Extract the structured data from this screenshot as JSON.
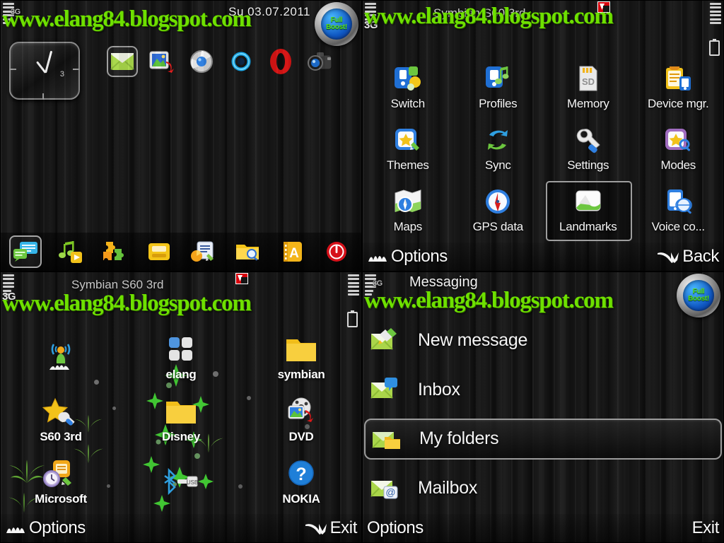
{
  "watermark": "www.elang84.blogspot.com",
  "colors": {
    "accent_green": "#6ee000",
    "label_white": "#f4f4f4",
    "selection_border": "#9e9e9e",
    "folder_yellow": "#f5c330",
    "opera_red": "#d61414"
  },
  "panel_home": {
    "status": {
      "network": "3G",
      "date": "Su 03.07.2011",
      "badge_line1": "Full",
      "badge_line2": "Boost!"
    },
    "clock": {
      "hour_marker": "3"
    },
    "shortcuts": [
      {
        "name": "messaging-shortcut",
        "label": "Messaging",
        "selected": true
      },
      {
        "name": "gallery-shortcut",
        "label": "Gallery",
        "selected": false
      },
      {
        "name": "web-browser-shortcut",
        "label": "Web",
        "selected": false
      },
      {
        "name": "widget-shortcut",
        "label": "Widget",
        "selected": false
      },
      {
        "name": "opera-browser-shortcut",
        "label": "Opera",
        "selected": false
      },
      {
        "name": "camera-shortcut",
        "label": "Camera",
        "selected": false
      }
    ],
    "dock": [
      {
        "name": "dock-messaging",
        "label": "Messaging",
        "selected": true
      },
      {
        "name": "dock-music-player",
        "label": "Music player",
        "selected": false
      },
      {
        "name": "dock-applications",
        "label": "Applications",
        "selected": false
      },
      {
        "name": "dock-gallery",
        "label": "Gallery",
        "selected": false
      },
      {
        "name": "dock-office",
        "label": "Office",
        "selected": false
      },
      {
        "name": "dock-file-manager",
        "label": "File manager",
        "selected": false
      },
      {
        "name": "dock-notes",
        "label": "Notes",
        "selected": false
      },
      {
        "name": "dock-power",
        "label": "Power",
        "selected": false
      }
    ]
  },
  "panel_tools": {
    "status": {
      "network": "3G",
      "operator": "Symbian S60 3rd"
    },
    "grid": [
      {
        "label": "Switch",
        "icon": "switch-icon",
        "selected": false
      },
      {
        "label": "Profiles",
        "icon": "profiles-icon",
        "selected": false
      },
      {
        "label": "Memory",
        "icon": "memory-card-icon",
        "selected": false
      },
      {
        "label": "Device mgr.",
        "icon": "device-manager-icon",
        "selected": false
      },
      {
        "label": "Themes",
        "icon": "themes-icon",
        "selected": false
      },
      {
        "label": "Sync",
        "icon": "sync-icon",
        "selected": false
      },
      {
        "label": "Settings",
        "icon": "settings-wrench-icon",
        "selected": false
      },
      {
        "label": "Modes",
        "icon": "modes-icon",
        "selected": false
      },
      {
        "label": "Maps",
        "icon": "maps-icon",
        "selected": false
      },
      {
        "label": "GPS data",
        "icon": "gps-compass-icon",
        "selected": false
      },
      {
        "label": "Landmarks",
        "icon": "landmarks-icon",
        "selected": true
      },
      {
        "label": "Voice co...",
        "icon": "voice-commands-icon",
        "selected": false
      }
    ],
    "softkeys": {
      "left": "Options",
      "right": "Back"
    }
  },
  "panel_folders": {
    "status": {
      "network": "3G",
      "operator": "Symbian S60 3rd"
    },
    "items": [
      {
        "label": "",
        "icon": "broadcast-antenna-icon",
        "selected": false
      },
      {
        "label": "elang",
        "icon": "elang-grid-icon",
        "selected": false
      },
      {
        "label": "symbian",
        "icon": "folder-icon",
        "selected": false
      },
      {
        "label": "S60 3rd",
        "icon": "s60-star-wrench-icon",
        "selected": false
      },
      {
        "label": "Disney",
        "icon": "folder-icon",
        "selected": false
      },
      {
        "label": "DVD",
        "icon": "dvd-media-icon",
        "selected": false
      },
      {
        "label": "Microsoft",
        "icon": "microsoft-clock-notes-icon",
        "selected": false
      },
      {
        "label": "",
        "icon": "bluetooth-usb-icon",
        "selected": false
      },
      {
        "label": "NOKIA",
        "icon": "nokia-help-icon",
        "selected": false
      }
    ],
    "softkeys": {
      "left": "Options",
      "right": "Exit"
    }
  },
  "panel_messaging": {
    "status": {
      "network": "3G",
      "title": "Messaging",
      "badge_line1": "Full",
      "badge_line2": "Boost!"
    },
    "items": [
      {
        "label": "New message",
        "icon": "new-message-icon",
        "selected": false
      },
      {
        "label": "Inbox",
        "icon": "inbox-icon",
        "selected": false
      },
      {
        "label": "My folders",
        "icon": "my-folders-icon",
        "selected": true
      },
      {
        "label": "Mailbox",
        "icon": "mailbox-icon",
        "selected": false
      }
    ],
    "softkeys": {
      "left": "Options",
      "right": "Exit"
    }
  }
}
